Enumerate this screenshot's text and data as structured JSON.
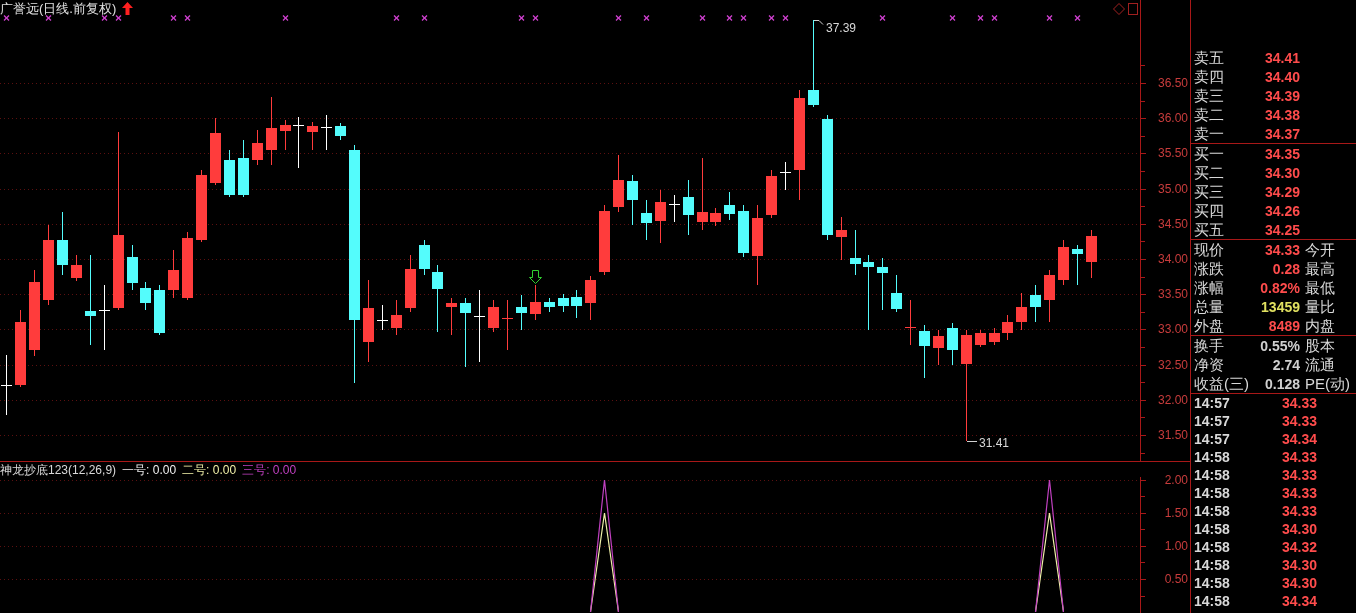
{
  "chart": {
    "title": "广誉远(日线.前复权)",
    "chart_data": {
      "type": "candlestick",
      "categories": [
        null,
        null,
        null,
        null,
        null,
        null,
        null,
        null,
        null,
        null,
        null,
        null,
        null,
        null,
        null,
        null,
        null,
        null,
        null,
        null,
        null,
        null,
        null,
        null,
        null,
        null,
        null,
        null,
        null,
        null,
        null,
        null,
        null,
        null,
        null,
        null,
        null,
        null,
        null,
        null,
        null,
        null,
        null,
        null,
        null,
        null,
        null,
        null,
        null,
        null,
        null,
        null,
        null,
        null,
        null,
        null,
        null,
        null,
        null,
        null,
        null,
        null,
        null,
        null,
        null,
        null,
        null,
        null,
        null,
        null,
        null,
        null,
        null,
        null,
        null,
        null,
        null,
        null,
        null,
        null,
        null,
        null
      ],
      "ylim": [
        31.13,
        37.68
      ],
      "grid": true,
      "yticks": [
        {
          "value": 36.5,
          "label": "36.50"
        },
        {
          "value": 36,
          "label": "36.00"
        },
        {
          "value": 35.5,
          "label": "35.50"
        },
        {
          "value": 35,
          "label": "35.00"
        },
        {
          "value": 34.5,
          "label": "34.50"
        },
        {
          "value": 34,
          "label": "34.00"
        },
        {
          "value": 33.5,
          "label": "33.50"
        },
        {
          "value": 33,
          "label": "33.00"
        },
        {
          "value": 32.5,
          "label": "32.50"
        },
        {
          "value": 32,
          "label": "32.00"
        },
        {
          "value": 31.5,
          "label": "31.50"
        }
      ],
      "ohlc": [
        [
          32.21,
          32.64,
          31.78,
          32.21
        ],
        [
          32.21,
          33.28,
          32.18,
          33.11
        ],
        [
          32.71,
          33.84,
          32.62,
          33.67
        ],
        [
          33.42,
          34.48,
          33.35,
          34.27
        ],
        [
          34.27,
          34.67,
          33.77,
          33.91
        ],
        [
          33.73,
          34.06,
          33.69,
          33.91
        ],
        [
          33.26,
          34.06,
          32.78,
          33.19
        ],
        [
          33.28,
          33.63,
          32.71,
          33.28
        ],
        [
          33.3,
          35.8,
          33.28,
          34.34
        ],
        [
          34.03,
          34.2,
          33.56,
          33.66
        ],
        [
          33.59,
          33.67,
          33.28,
          33.38
        ],
        [
          33.56,
          33.63,
          32.92,
          32.95
        ],
        [
          33.56,
          34.13,
          33.45,
          33.84
        ],
        [
          33.45,
          34.38,
          33.42,
          34.3
        ],
        [
          34.27,
          35.26,
          34.24,
          35.19
        ],
        [
          35.08,
          36.0,
          35.05,
          35.79
        ],
        [
          35.41,
          35.55,
          34.88,
          34.91
        ],
        [
          35.43,
          35.69,
          34.88,
          34.91
        ],
        [
          35.41,
          35.83,
          35.34,
          35.65
        ],
        [
          35.55,
          36.3,
          35.34,
          35.86
        ],
        [
          35.82,
          35.97,
          35.55,
          35.9
        ],
        [
          35.9,
          36.02,
          35.29,
          35.9
        ],
        [
          35.8,
          35.95,
          35.55,
          35.89
        ],
        [
          35.88,
          36.05,
          35.55,
          35.88
        ],
        [
          35.89,
          35.93,
          35.69,
          35.75
        ],
        [
          35.55,
          35.62,
          32.24,
          33.13
        ],
        [
          32.82,
          33.7,
          32.54,
          33.3
        ],
        [
          33.13,
          33.35,
          32.99,
          33.13
        ],
        [
          33.02,
          33.42,
          32.92,
          33.2
        ],
        [
          33.3,
          34.06,
          33.25,
          33.86
        ],
        [
          34.2,
          34.27,
          33.77,
          33.86
        ],
        [
          33.82,
          33.91,
          32.96,
          33.57
        ],
        [
          33.32,
          33.45,
          32.92,
          33.38
        ],
        [
          33.38,
          33.45,
          32.47,
          33.23
        ],
        [
          33.19,
          33.56,
          32.54,
          33.19
        ],
        [
          33.02,
          33.42,
          32.96,
          33.32
        ],
        [
          33.15,
          33.42,
          32.71,
          33.16
        ],
        [
          33.32,
          33.49,
          32.99,
          33.23
        ],
        [
          33.22,
          33.63,
          33.13,
          33.39
        ],
        [
          33.39,
          33.45,
          33.25,
          33.32
        ],
        [
          33.45,
          33.5,
          33.25,
          33.33
        ],
        [
          33.46,
          33.56,
          33.16,
          33.33
        ],
        [
          33.38,
          33.76,
          33.13,
          33.7
        ],
        [
          33.82,
          34.77,
          33.77,
          34.68
        ],
        [
          34.74,
          35.48,
          34.67,
          35.12
        ],
        [
          35.11,
          35.19,
          34.48,
          34.84
        ],
        [
          34.65,
          34.84,
          34.27,
          34.51
        ],
        [
          34.54,
          34.98,
          34.23,
          34.81
        ],
        [
          34.78,
          34.91,
          34.53,
          34.78
        ],
        [
          34.88,
          35.12,
          34.34,
          34.63
        ],
        [
          34.53,
          35.43,
          34.41,
          34.67
        ],
        [
          34.53,
          34.72,
          34.47,
          34.65
        ],
        [
          34.77,
          34.95,
          34.55,
          34.64
        ],
        [
          34.68,
          34.77,
          34.03,
          34.09
        ],
        [
          34.04,
          34.77,
          33.63,
          34.58
        ],
        [
          34.63,
          35.26,
          34.58,
          35.18
        ],
        [
          35.24,
          35.38,
          34.98,
          35.24
        ],
        [
          35.26,
          36.4,
          34.84,
          36.29
        ],
        [
          36.4,
          37.39,
          36.16,
          36.19
        ],
        [
          35.99,
          36.05,
          34.27,
          34.34
        ],
        [
          34.31,
          34.6,
          33.99,
          34.41
        ],
        [
          34.01,
          34.41,
          33.77,
          33.93
        ],
        [
          33.96,
          34.06,
          32.99,
          33.89
        ],
        [
          33.89,
          34.01,
          33.28,
          33.8
        ],
        [
          33.52,
          33.77,
          33.25,
          33.29
        ],
        [
          33.02,
          33.42,
          32.78,
          33.03
        ],
        [
          32.98,
          33.06,
          32.31,
          32.76
        ],
        [
          32.74,
          32.99,
          32.49,
          32.91
        ],
        [
          33.02,
          33.09,
          32.49,
          32.71
        ],
        [
          32.51,
          32.99,
          31.41,
          32.92
        ],
        [
          32.78,
          32.99,
          32.75,
          32.95
        ],
        [
          32.82,
          33.02,
          32.78,
          32.95
        ],
        [
          32.95,
          33.2,
          32.85,
          33.11
        ],
        [
          33.11,
          33.52,
          32.99,
          33.32
        ],
        [
          33.49,
          33.63,
          33.11,
          33.32
        ],
        [
          33.42,
          33.84,
          33.11,
          33.77
        ],
        [
          33.7,
          34.27,
          33.63,
          34.17
        ],
        [
          34.14,
          34.2,
          33.63,
          34.07
        ],
        [
          33.96,
          34.41,
          33.73,
          34.33
        ],
        null,
        null,
        null
      ],
      "annotations": [
        {
          "text": "37.39"
        },
        {
          "text": "31.41"
        }
      ]
    }
  },
  "indicator": {
    "title": "神龙抄底123(12,26,9)",
    "legend": [
      {
        "value": ": 0.00"
      },
      {
        "value": ": 0.00"
      },
      {
        "value": ": 0.00"
      }
    ],
    "chart_data": {
      "type": "line",
      "categories": [
        null,
        null,
        null,
        null,
        null,
        null,
        null,
        null,
        null,
        null,
        null,
        null,
        null,
        null,
        null,
        null,
        null,
        null,
        null,
        null,
        null,
        null,
        null,
        null,
        null,
        null,
        null,
        null,
        null,
        null,
        null,
        null,
        null,
        null,
        null,
        null,
        null,
        null,
        null,
        null,
        null,
        null,
        null,
        null,
        null,
        null,
        null,
        null,
        null,
        null,
        null,
        null,
        null,
        null,
        null,
        null,
        null,
        null,
        null,
        null,
        null,
        null,
        null,
        null,
        null,
        null,
        null,
        null,
        null,
        null,
        null,
        null,
        null,
        null,
        null,
        null,
        null,
        null,
        null,
        null,
        null,
        null
      ],
      "ylim": [
        -0.015,
        2.045
      ],
      "grid": true,
      "yticks": [
        {
          "value": 2,
          "label": "2.00"
        },
        {
          "value": 1.5,
          "label": "1.50"
        },
        {
          "value": 1,
          "label": "1.00"
        },
        {
          "value": 0.5,
          "label": "0.50"
        }
      ],
      "series": [
        {
          "name": "一号",
          "color": "#f0f0f0",
          "values": [
            null,
            null,
            null,
            null,
            null,
            null,
            null,
            null,
            null,
            null,
            null,
            null,
            null,
            null,
            null,
            null,
            null,
            null,
            null,
            null,
            null,
            null,
            null,
            null,
            null,
            null,
            null,
            null,
            null,
            null,
            null,
            null,
            null,
            null,
            null,
            null,
            null,
            null,
            null,
            null,
            null,
            null,
            null,
            null,
            null,
            null,
            null,
            null,
            null,
            null,
            null,
            null,
            null,
            null,
            null,
            null,
            null,
            null,
            null,
            null,
            null,
            null,
            null,
            null,
            null,
            null,
            null,
            null,
            null,
            null,
            null,
            null,
            null,
            null,
            null,
            null,
            null,
            null,
            null,
            null,
            null,
            null
          ]
        },
        {
          "name": "二号",
          "color": "#f0f0a8",
          "values": [
            null,
            null,
            null,
            null,
            null,
            null,
            null,
            null,
            null,
            null,
            null,
            null,
            null,
            null,
            null,
            null,
            null,
            null,
            null,
            null,
            null,
            null,
            null,
            null,
            null,
            null,
            null,
            null,
            null,
            null,
            null,
            null,
            null,
            null,
            null,
            null,
            null,
            null,
            null,
            null,
            null,
            null,
            0,
            1.5,
            0,
            null,
            null,
            null,
            null,
            null,
            null,
            null,
            null,
            null,
            null,
            null,
            null,
            null,
            null,
            null,
            null,
            null,
            null,
            null,
            null,
            null,
            null,
            null,
            null,
            null,
            null,
            null,
            null,
            null,
            0,
            1.5,
            0,
            null,
            null,
            null,
            null,
            null
          ]
        },
        {
          "name": "三号",
          "color": "#c040c0",
          "values": [
            null,
            null,
            null,
            null,
            null,
            null,
            null,
            null,
            null,
            null,
            null,
            null,
            null,
            null,
            null,
            null,
            null,
            null,
            null,
            null,
            null,
            null,
            null,
            null,
            null,
            null,
            null,
            null,
            null,
            null,
            null,
            null,
            null,
            null,
            null,
            null,
            null,
            null,
            null,
            null,
            null,
            null,
            0,
            2,
            0,
            null,
            null,
            null,
            null,
            null,
            null,
            null,
            null,
            null,
            null,
            null,
            null,
            null,
            null,
            null,
            null,
            null,
            null,
            null,
            null,
            null,
            null,
            null,
            null,
            null,
            null,
            null,
            null,
            null,
            0,
            2,
            0,
            null,
            null,
            null,
            null,
            null
          ]
        }
      ]
    }
  },
  "quote": {
    "asks": [
      {
        "label": "卖五",
        "price": "34.41"
      },
      {
        "label": "卖四",
        "price": "34.40"
      },
      {
        "label": "卖三",
        "price": "34.39"
      },
      {
        "label": "卖二",
        "price": "34.38"
      },
      {
        "label": "卖一",
        "price": "34.37"
      }
    ],
    "bids": [
      {
        "label": "买一",
        "price": "34.35"
      },
      {
        "label": "买二",
        "price": "34.30"
      },
      {
        "label": "买三",
        "price": "34.29"
      },
      {
        "label": "买四",
        "price": "34.26"
      },
      {
        "label": "买五",
        "price": "34.25"
      }
    ],
    "stats": [
      {
        "label": "现价",
        "value": "34.33",
        "color": "#ff4c4c",
        "label_2": "今开"
      },
      {
        "label": "涨跌",
        "value": "0.28",
        "color": "#ff4c4c",
        "label_2": "最高"
      },
      {
        "label": "涨幅",
        "value": "0.82%",
        "color": "#ff4c4c",
        "label_2": "最低"
      },
      {
        "label": "总量",
        "value": "13459",
        "color": "#e0e060",
        "label_2": "量比"
      },
      {
        "label": "外盘",
        "value": "8489",
        "color": "#ff4c4c",
        "label_2": "内盘"
      }
    ],
    "fundamentals": [
      {
        "label": "换手",
        "value": "0.55%",
        "label_2": "股本"
      },
      {
        "label": "净资",
        "value": "2.74",
        "label_2": "流通"
      },
      {
        "label": "收益(三)",
        "value": "0.128",
        "label_2": "PE(动)"
      }
    ],
    "ticks": [
      {
        "time": "14:57",
        "price": "34.33"
      },
      {
        "time": "14:57",
        "price": "34.33"
      },
      {
        "time": "14:57",
        "price": "34.34"
      },
      {
        "time": "14:58",
        "price": "34.33"
      },
      {
        "time": "14:58",
        "price": "34.33"
      },
      {
        "time": "14:58",
        "price": "34.33"
      },
      {
        "time": "14:58",
        "price": "34.33"
      },
      {
        "time": "14:58",
        "price": "34.30"
      },
      {
        "time": "14:58",
        "price": "34.32"
      },
      {
        "time": "14:58",
        "price": "34.30"
      },
      {
        "time": "14:58",
        "price": "34.30"
      },
      {
        "time": "14:58",
        "price": "34.34"
      }
    ]
  }
}
